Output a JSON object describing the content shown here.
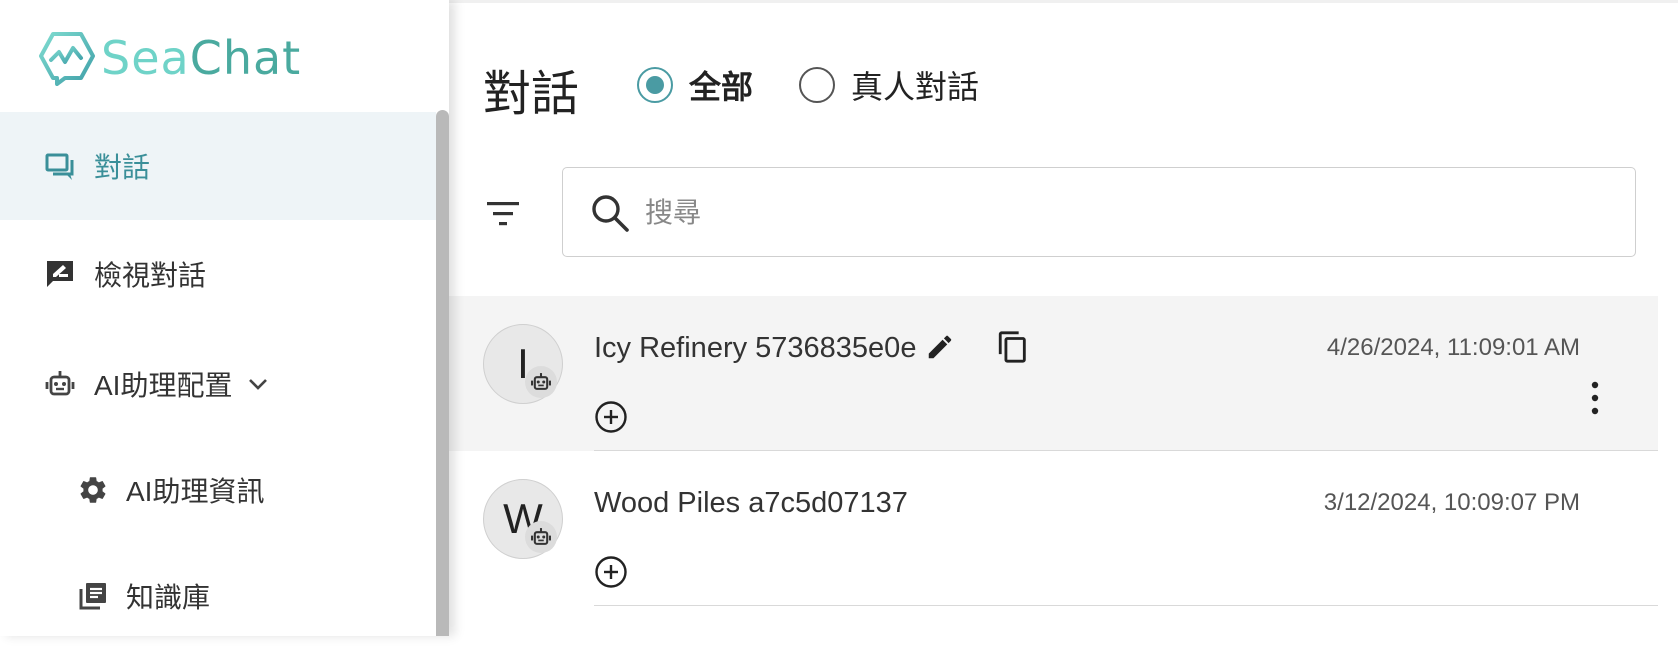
{
  "brand": {
    "name_part1": "Sea",
    "name_part2": "Chat",
    "accent": "#4a9ba3"
  },
  "sidebar": {
    "items": [
      {
        "label": "對話",
        "icon": "forum-icon",
        "active": true
      },
      {
        "label": "檢視對話",
        "icon": "rate-review-icon",
        "active": false
      },
      {
        "label": "AI助理配置",
        "icon": "bot-icon",
        "expanded": true
      },
      {
        "label": "AI助理資訊",
        "icon": "gear-icon",
        "sub": true
      },
      {
        "label": "知識庫",
        "icon": "library-books-icon",
        "sub": true
      }
    ]
  },
  "main": {
    "title": "對話",
    "filter_options": [
      {
        "label": "全部",
        "checked": true
      },
      {
        "label": "真人對話",
        "checked": false
      }
    ],
    "search": {
      "placeholder": "搜尋",
      "value": ""
    }
  },
  "conversations": [
    {
      "initial": "I",
      "name": "Icy Refinery 5736835e0e",
      "timestamp": "4/26/2024, 11:09:01 AM",
      "selected": true
    },
    {
      "initial": "W",
      "name": "Wood Piles a7c5d07137",
      "timestamp": "3/12/2024, 10:09:07 PM",
      "selected": false
    }
  ]
}
